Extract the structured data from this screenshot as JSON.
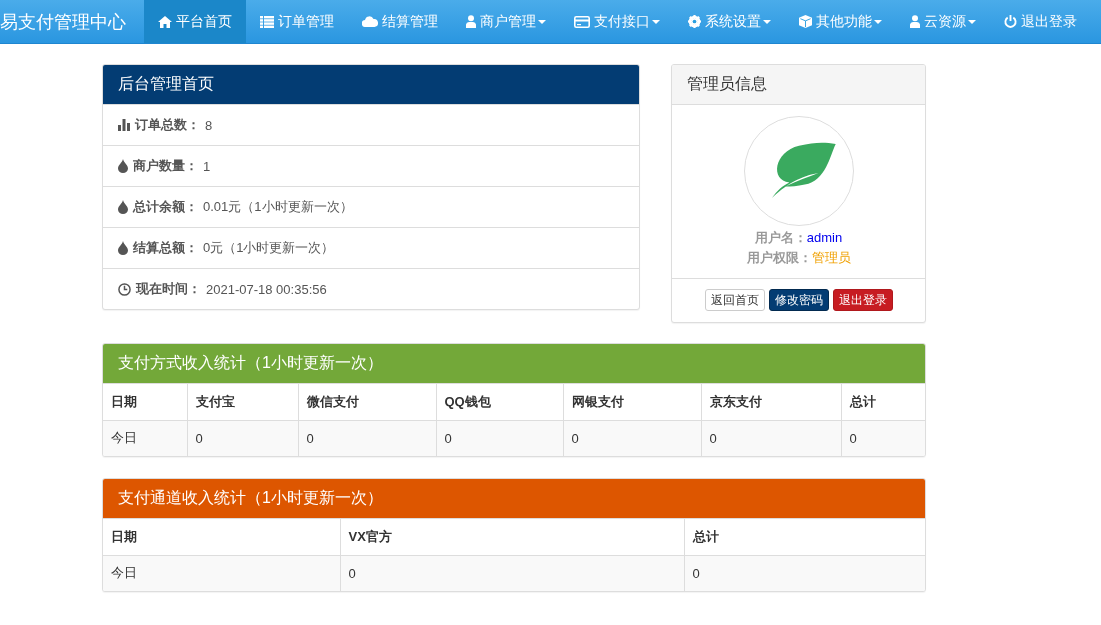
{
  "navbar": {
    "brand": "易支付管理中心",
    "items": [
      {
        "label": "平台首页",
        "kind": "home",
        "dropdown": false,
        "selected": true
      },
      {
        "label": "订单管理",
        "kind": "list",
        "dropdown": false,
        "selected": false
      },
      {
        "label": "结算管理",
        "kind": "cloud",
        "dropdown": false,
        "selected": false
      },
      {
        "label": "商户管理",
        "kind": "user",
        "dropdown": true,
        "selected": false
      },
      {
        "label": "支付接口",
        "kind": "card",
        "dropdown": true,
        "selected": false
      },
      {
        "label": "系统设置",
        "kind": "gear",
        "dropdown": true,
        "selected": false
      },
      {
        "label": "其他功能",
        "kind": "cube",
        "dropdown": true,
        "selected": false
      },
      {
        "label": "云资源",
        "kind": "user",
        "dropdown": true,
        "selected": false
      },
      {
        "label": "退出登录",
        "kind": "power",
        "dropdown": false,
        "selected": false
      }
    ]
  },
  "overview": {
    "title": "后台管理首页",
    "stats": [
      {
        "kind": "bars",
        "label": "订单总数：",
        "value": "8"
      },
      {
        "kind": "drop",
        "label": "商户数量：",
        "value": "1"
      },
      {
        "kind": "drop",
        "label": "总计余额：",
        "value": "0.01元（1小时更新一次）"
      },
      {
        "kind": "drop",
        "label": "结算总额：",
        "value": "0元（1小时更新一次）"
      },
      {
        "kind": "clock",
        "label": "现在时间：",
        "value": "2021-07-18 00:35:56"
      }
    ]
  },
  "admin": {
    "title": "管理员信息",
    "username_label": "用户名：",
    "username": "admin",
    "role_label": "用户权限：",
    "role": "管理员",
    "buttons": [
      {
        "label": "返回首页",
        "kind": "default"
      },
      {
        "label": "修改密码",
        "kind": "primary"
      },
      {
        "label": "退出登录",
        "kind": "danger"
      }
    ]
  },
  "tables": [
    {
      "title": "支付方式收入统计（1小时更新一次）",
      "kind": "method",
      "columns": [
        "日期",
        "支付宝",
        "微信支付",
        "QQ钱包",
        "网银支付",
        "京东支付",
        "总计"
      ],
      "rows": [
        [
          "今日",
          "0",
          "0",
          "0",
          "0",
          "0",
          "0"
        ]
      ]
    },
    {
      "title": "支付通道收入统计（1小时更新一次）",
      "kind": "channel",
      "columns": [
        "日期",
        "VX官方",
        "总计"
      ],
      "rows": [
        [
          "今日",
          "0",
          "0"
        ]
      ]
    }
  ]
}
